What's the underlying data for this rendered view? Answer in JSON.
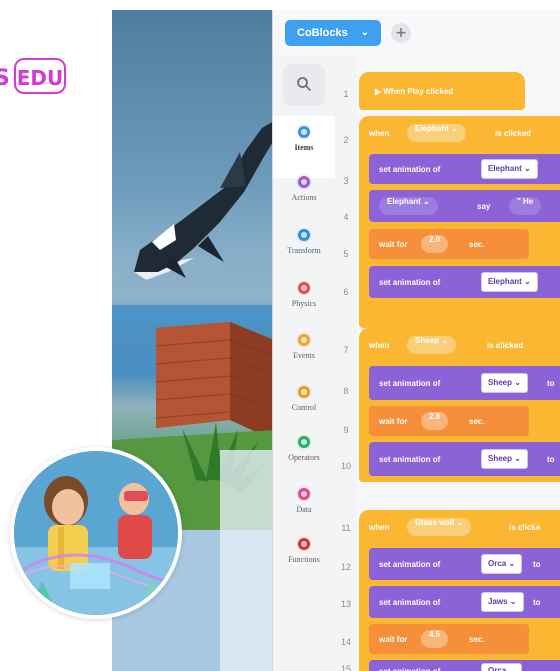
{
  "brand": {
    "s_fragment": "S",
    "edu_label": "EDU",
    "accent": "#d43bd6"
  },
  "toolbar": {
    "tab_label": "CoBlocks",
    "tab_chevron": "⌄",
    "add_label": "+"
  },
  "sidebar": {
    "search_icon": "search-icon",
    "categories": [
      {
        "label": "Items",
        "color": "#3b8fe4",
        "active": true
      },
      {
        "label": "Actions",
        "color": "#9b59d9"
      },
      {
        "label": "Transform",
        "color": "#2e8fe0"
      },
      {
        "label": "Physics",
        "color": "#e74c3c"
      },
      {
        "label": "Events",
        "color": "#f5a623"
      },
      {
        "label": "Control",
        "color": "#f39c12"
      },
      {
        "label": "Operators",
        "color": "#27ae60"
      },
      {
        "label": "Data",
        "color": "#e84393"
      },
      {
        "label": "Functions",
        "color": "#d63031"
      }
    ]
  },
  "line_numbers": [
    "1",
    "2",
    "3",
    "4",
    "5",
    "6",
    "7",
    "8",
    "9",
    "10",
    "11",
    "12",
    "13",
    "14",
    "15"
  ],
  "code": {
    "play": "▶ When Play clicked",
    "when": "when",
    "is_clicked": "is clicked",
    "is_clicked_cut": "is clicke",
    "set_animation_of": "set animation of",
    "say": "say",
    "say_value": "\" He",
    "wait_for": "wait for",
    "sec": "sec.",
    "to": "to",
    "elephant": "Elephant ⌄",
    "sheep": "Sheep ⌄",
    "glass_wall": "Glass wall ⌄",
    "orca": "Orca ⌄",
    "jaws": "Jaws ⌄",
    "wait_values": [
      "2.0",
      "2.8",
      "4.5"
    ]
  }
}
